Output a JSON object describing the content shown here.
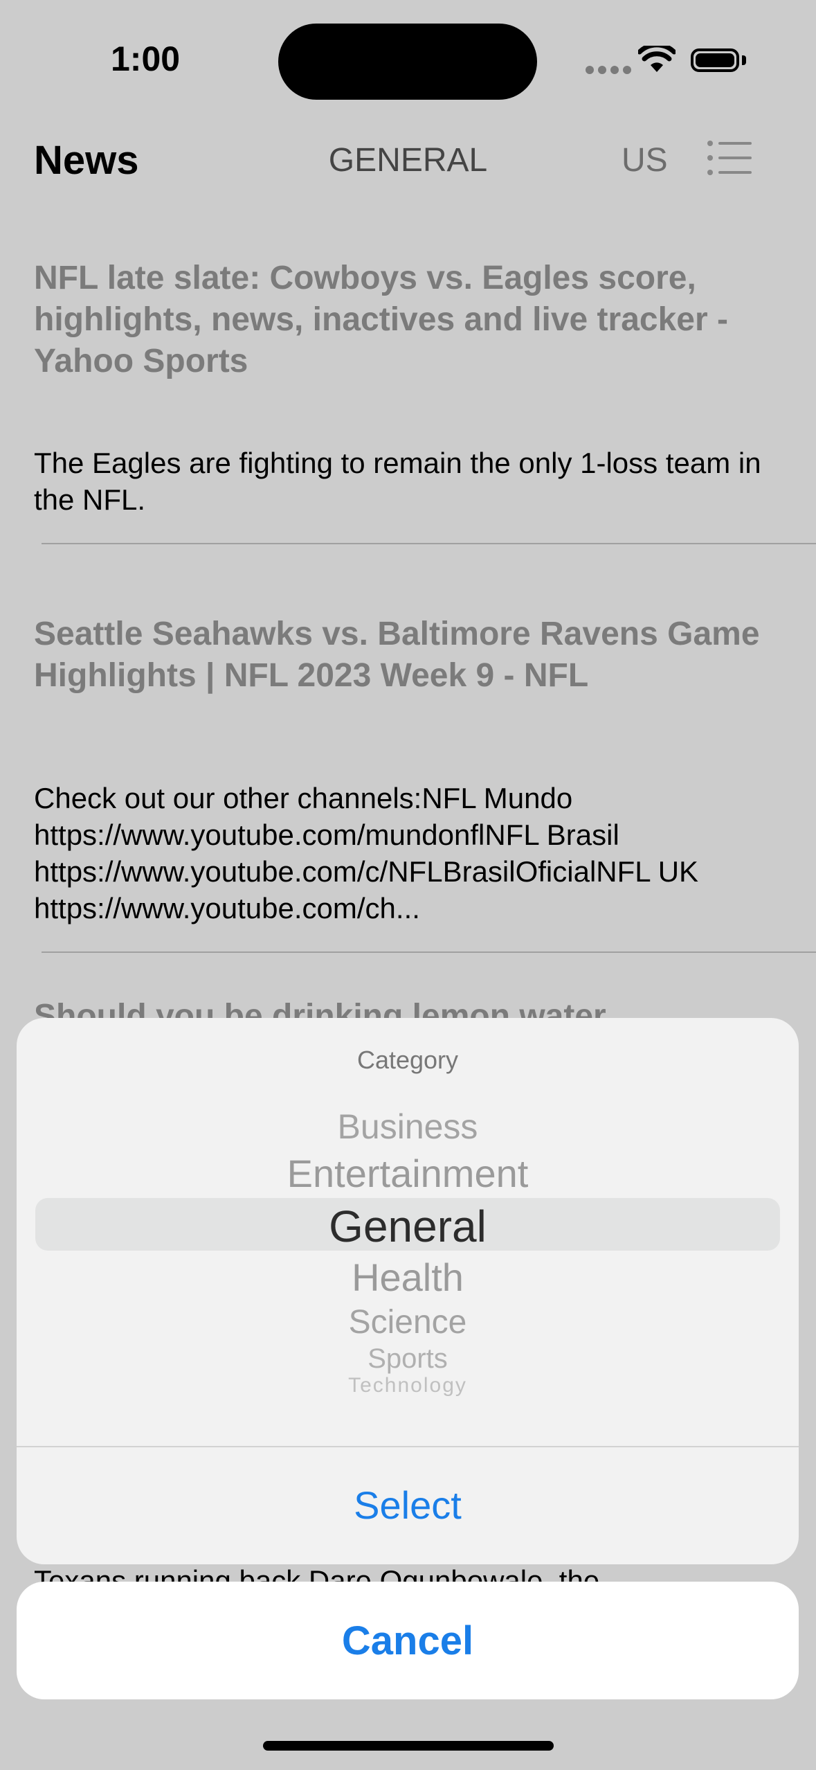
{
  "status_bar": {
    "time": "1:00"
  },
  "nav": {
    "title": "News",
    "category": "GENERAL",
    "country": "US"
  },
  "articles": [
    {
      "headline": "NFL late slate: Cowboys vs. Eagles score, highlights, news, inactives and live tracker - Yahoo Sports",
      "summary": "The Eagles are fighting to remain the only 1-loss team in the NFL."
    },
    {
      "headline": "Seattle Seahawks vs. Baltimore Ravens Game Highlights | NFL 2023 Week 9 - NFL",
      "summary": "Check out our other channels:NFL Mundo https://www.youtube.com/mundonflNFL Brasil https://www.youtube.com/c/NFLBrasilOficialNFL UK https://www.youtube.com/ch..."
    },
    {
      "headline": "Should you be drinking lemon water",
      "summary": "Texans running back Dare Ogunbowale, the"
    }
  ],
  "picker": {
    "title": "Category",
    "options": [
      "Business",
      "Entertainment",
      "General",
      "Health",
      "Science",
      "Sports",
      "Technology"
    ],
    "selected": "General",
    "select_label": "Select"
  },
  "cancel_label": "Cancel",
  "colors": {
    "accent": "#1a7ee8",
    "headline_gray": "#9a9a9a"
  },
  "icons": [
    "cellular-signal-icon",
    "wifi-icon",
    "battery-icon",
    "list-icon"
  ]
}
